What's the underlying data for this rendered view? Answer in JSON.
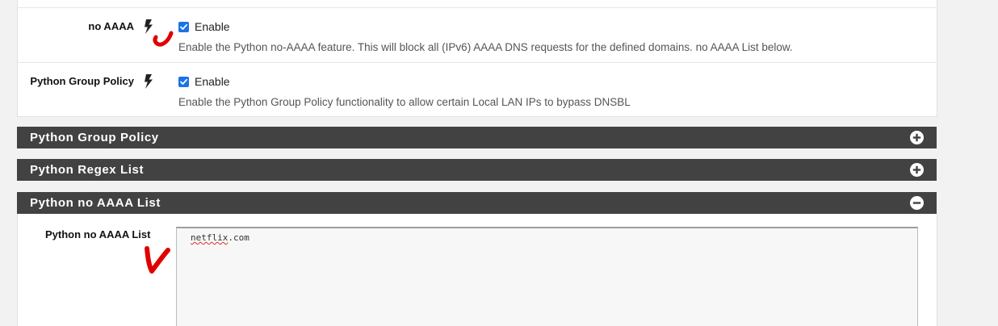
{
  "settings": {
    "no_aaaa": {
      "label": "no AAAA",
      "checkbox_label": "Enable",
      "checked": true,
      "help": "Enable the Python no-AAAA feature. This will block all (IPv6) AAAA DNS requests for the defined domains. no AAAA List below."
    },
    "group_policy": {
      "label": "Python Group Policy",
      "checkbox_label": "Enable",
      "checked": true,
      "help": "Enable the Python Group Policy functionality to allow certain Local LAN IPs to bypass DNSBL"
    }
  },
  "sections": [
    {
      "title": "Python Group Policy",
      "state": "collapsed",
      "icon": "plus-circle-icon"
    },
    {
      "title": "Python Regex List",
      "state": "collapsed",
      "icon": "plus-circle-icon"
    },
    {
      "title": "Python no AAAA List",
      "state": "expanded",
      "icon": "minus-circle-icon"
    }
  ],
  "no_aaaa_list": {
    "label": "Python no AAAA List",
    "value_word": "netflix",
    "value_rest": ".com"
  },
  "colors": {
    "section_bar": "#424242",
    "checkbox": "#1a73e8",
    "annotation": "#e00000"
  }
}
